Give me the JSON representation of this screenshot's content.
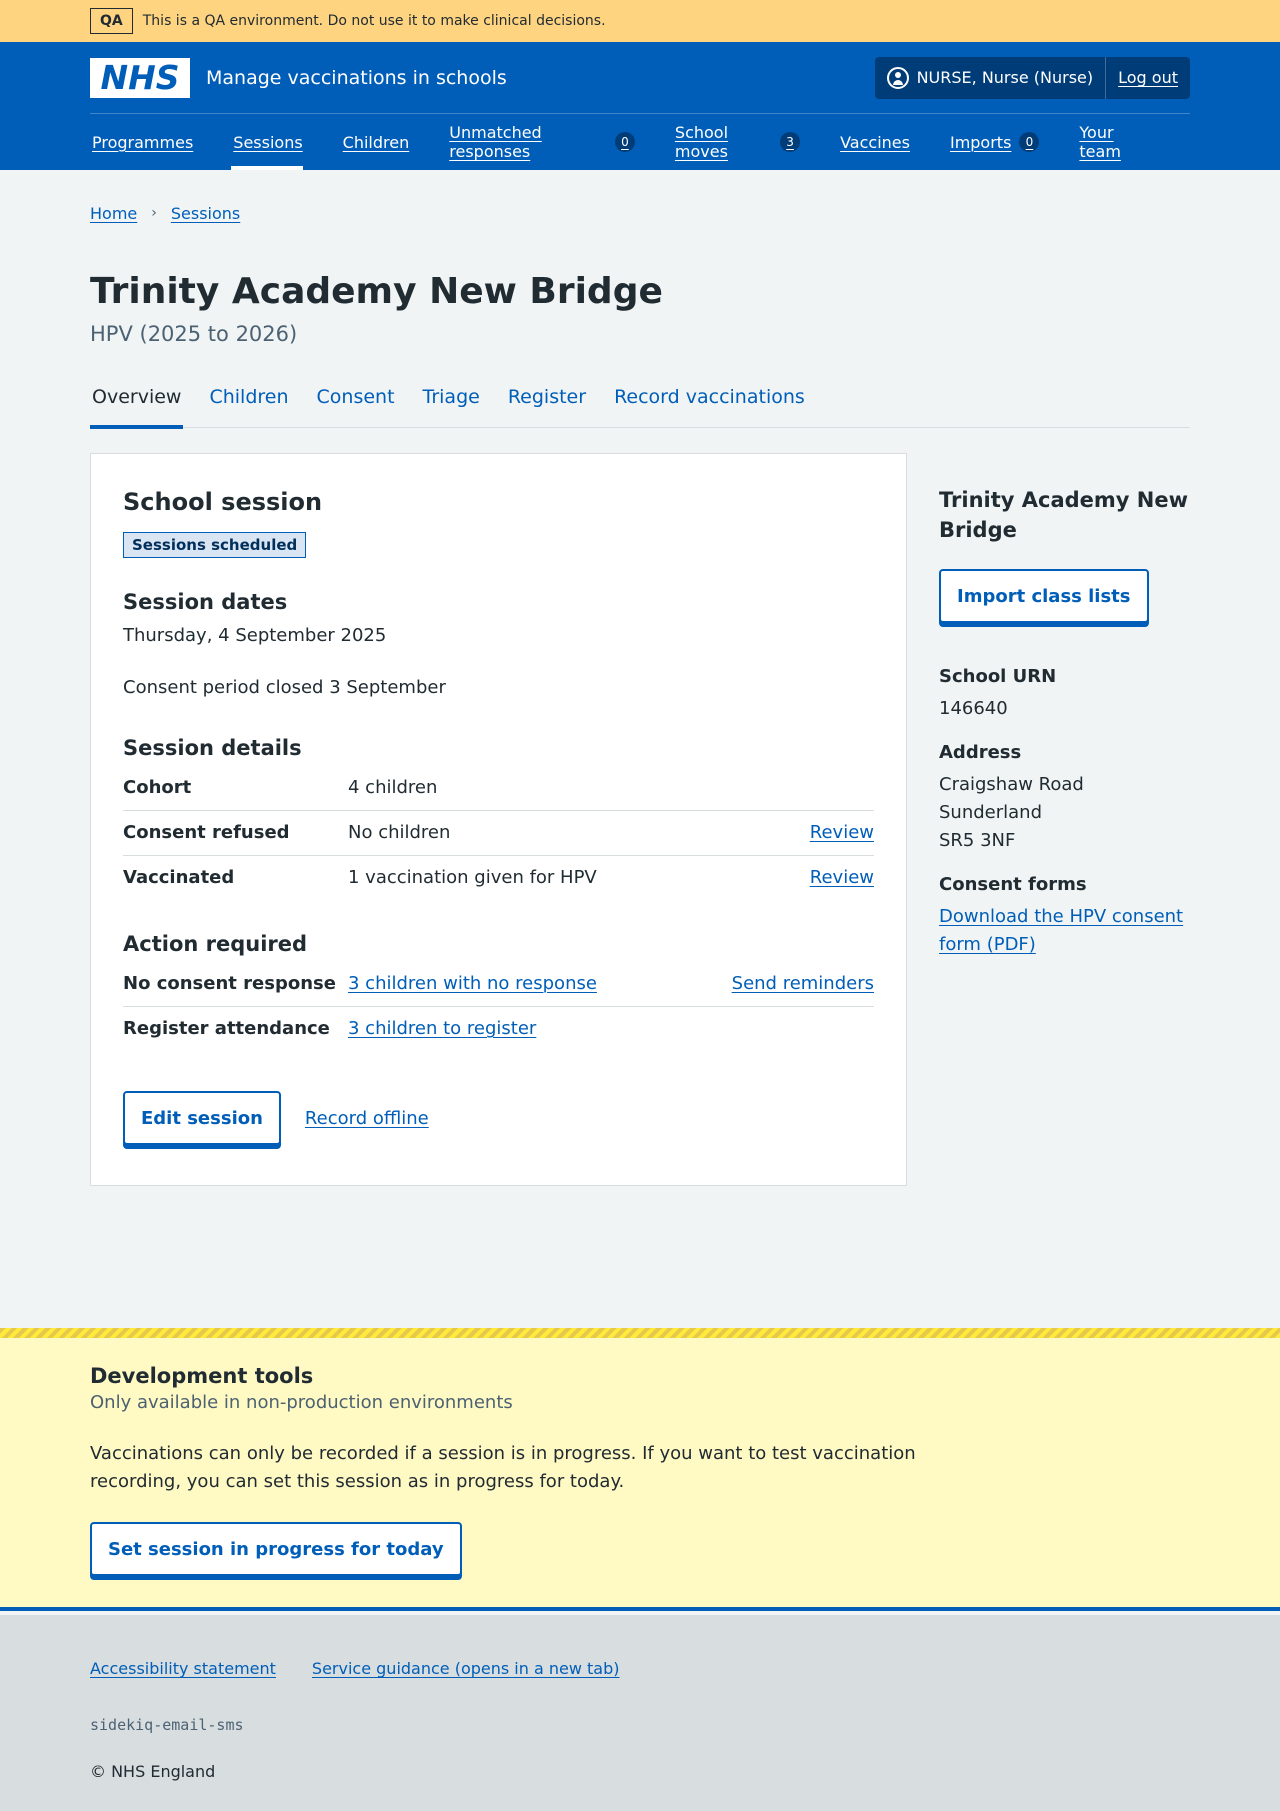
{
  "qa_banner": {
    "tag": "QA",
    "text": "This is a QA environment. Do not use it to make clinical decisions."
  },
  "header": {
    "logo": "NHS",
    "service_name": "Manage vaccinations in schools",
    "user": "NURSE, Nurse (Nurse)",
    "logout": "Log out",
    "nav": [
      {
        "label": "Programmes"
      },
      {
        "label": "Sessions",
        "current": true
      },
      {
        "label": "Children"
      },
      {
        "label": "Unmatched responses",
        "count": "0"
      },
      {
        "label": "School moves",
        "count": "3"
      },
      {
        "label": "Vaccines"
      },
      {
        "label": "Imports",
        "count": "0"
      },
      {
        "label": "Your team"
      }
    ]
  },
  "breadcrumb": {
    "home": "Home",
    "sessions": "Sessions"
  },
  "page": {
    "title": "Trinity Academy New Bridge",
    "caption": "HPV (2025 to 2026)"
  },
  "tabs": [
    "Overview",
    "Children",
    "Consent",
    "Triage",
    "Register",
    "Record vaccinations"
  ],
  "session": {
    "heading": "School session",
    "status_tag": "Sessions scheduled",
    "dates_heading": "Session dates",
    "date": "Thursday, 4 September 2025",
    "consent_period": "Consent period closed 3 September",
    "details_heading": "Session details",
    "details": [
      {
        "key": "Cohort",
        "value": "4 children",
        "action": ""
      },
      {
        "key": "Consent refused",
        "value": "No children",
        "action": "Review"
      },
      {
        "key": "Vaccinated",
        "value": "1 vaccination given for HPV",
        "action": "Review"
      }
    ],
    "action_heading": "Action required",
    "actions": [
      {
        "key": "No consent response",
        "value": "3 children with no response",
        "action": "Send reminders"
      },
      {
        "key": "Register attendance",
        "value": "3 children to register",
        "action": ""
      }
    ],
    "edit_button": "Edit session",
    "record_offline": "Record offline"
  },
  "sidebar": {
    "title": "Trinity Academy New Bridge",
    "import_button": "Import class lists",
    "urn_label": "School URN",
    "urn": "146640",
    "address_label": "Address",
    "address": [
      "Craigshaw Road",
      "Sunderland",
      "SR5 3NF"
    ],
    "consent_label": "Consent forms",
    "consent_link": "Download the HPV consent form (PDF)"
  },
  "devtools": {
    "title": "Development tools",
    "caption": "Only available in non-production environments",
    "text": "Vaccinations can only be recorded if a session is in progress. If you want to test vaccination recording, you can set this session as in progress for today.",
    "button": "Set session in progress for today"
  },
  "footer": {
    "links": [
      "Accessibility statement",
      "Service guidance (opens in a new tab)"
    ],
    "mono": "sidekiq-email-sms",
    "copyright": "© NHS England"
  }
}
